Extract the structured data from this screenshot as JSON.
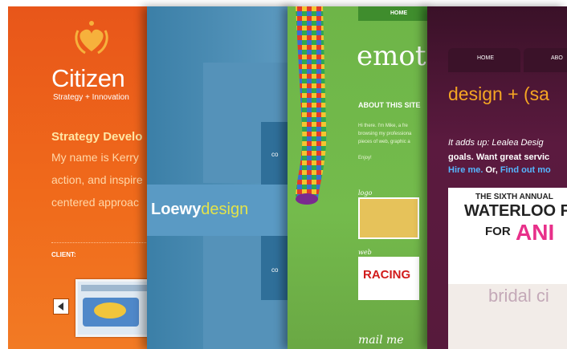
{
  "panels": {
    "citizen": {
      "brand": "Citizen",
      "tagline": "Strategy + Innovation",
      "heading": "Strategy Develo",
      "body_lines": [
        "My name is Kerry",
        "action, and inspire",
        "centered approac"
      ],
      "client_label": "CLIENT:",
      "icon": "heart-laurel-icon",
      "colors": {
        "bg": "#ef5f1b",
        "heading": "#ffe7a5"
      }
    },
    "loewy": {
      "brand_part1": "Loewy",
      "brand_part2": "design",
      "corner_text_1": "co",
      "corner_text_2": "co",
      "colors": {
        "bg": "#4b8bb4",
        "accent": "#e3e34a"
      }
    },
    "emot": {
      "nav_home": "HOME",
      "brand": "emot",
      "about_heading": "ABOUT THIS SITE",
      "about_lines": [
        "Hi there. I'm Mike, a fre",
        "browsing my professiona",
        "pieces of web, graphic a",
        "Enjoy!"
      ],
      "label_logo": "logo",
      "label_web": "web",
      "racing_text": "RACING",
      "footer_text": "mail me",
      "colors": {
        "bg": "#72b94b"
      }
    },
    "lealea": {
      "tab_home": "HOME",
      "tab_about": "ABO",
      "brand": "design + (sa",
      "line1": "It adds up: Lealea Desig",
      "line2": "goals. Want great servic",
      "line3_link1": "Hire me.",
      "line3_mid": " Or, ",
      "line3_link2": "Find out mo",
      "poster_sixth": "THE SIXTH ANNUAL",
      "poster_waterloo": "WATERLOO FES",
      "poster_for": "FOR",
      "poster_ani": "ANI",
      "bridal_text": "bridal ci",
      "colors": {
        "bg": "#571a3c",
        "brand": "#f5a623",
        "link": "#55b6ff"
      }
    }
  }
}
